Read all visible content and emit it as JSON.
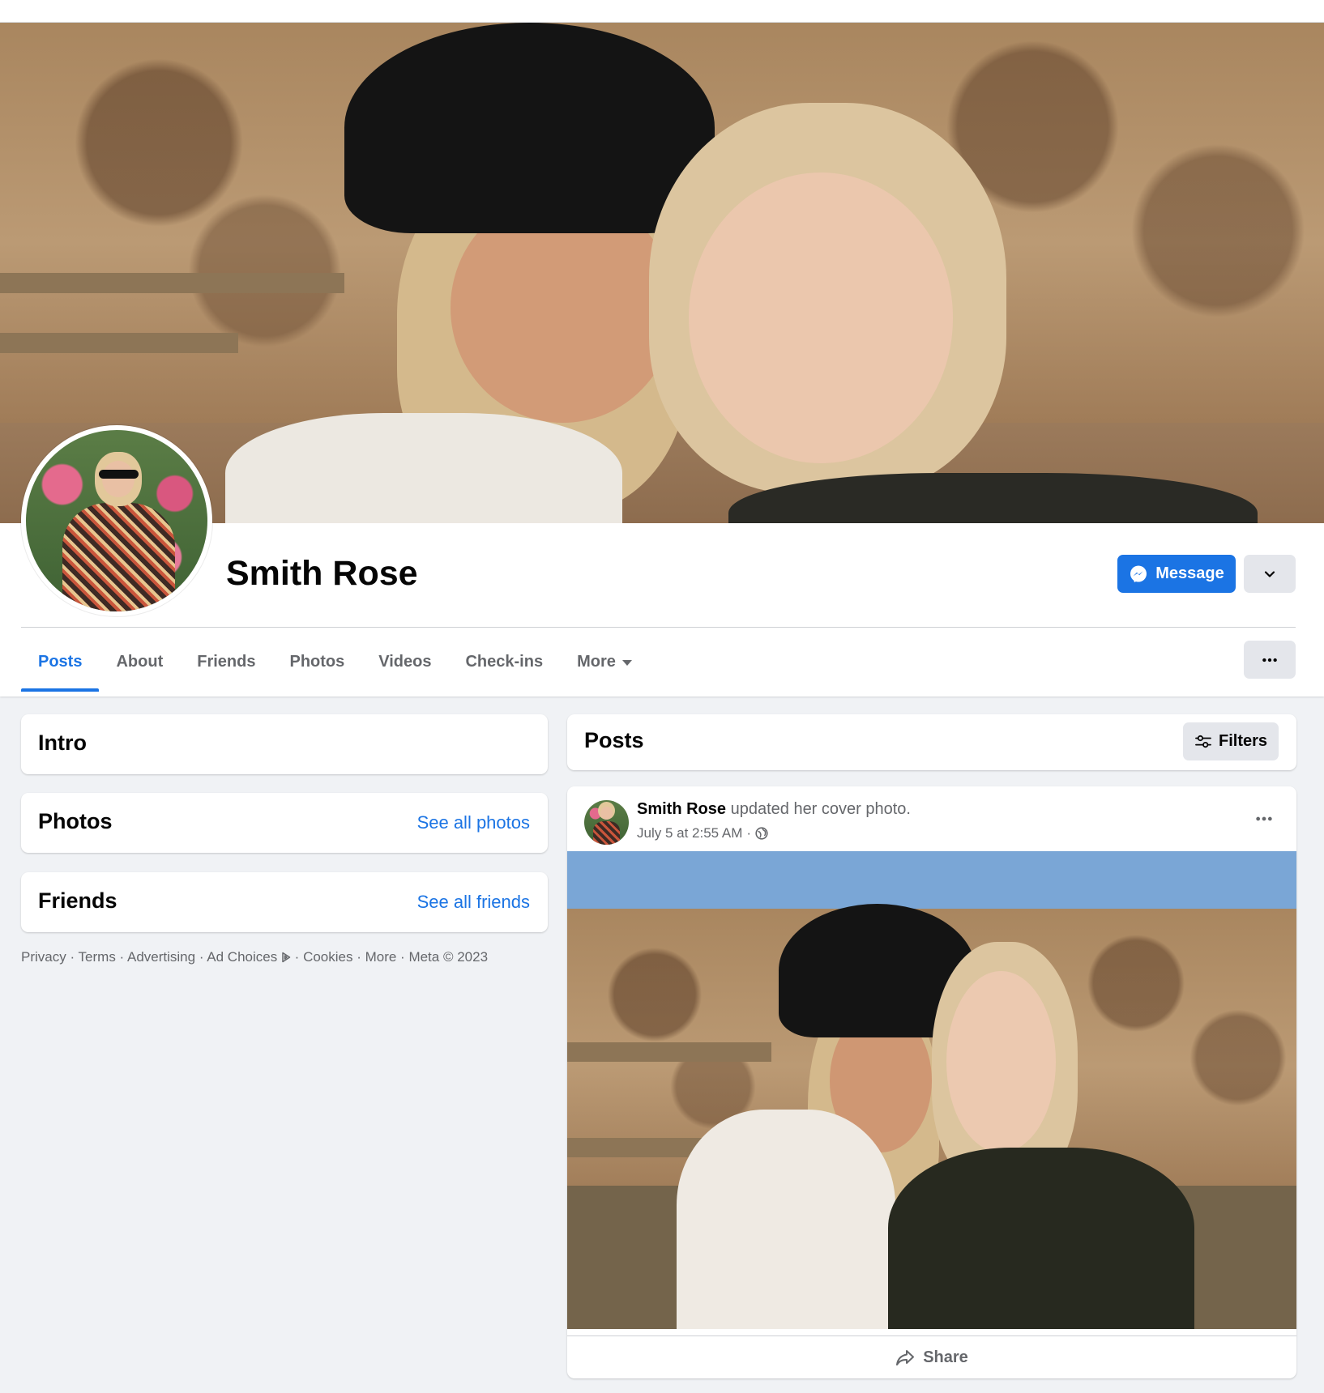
{
  "profile": {
    "name": "Smith Rose",
    "message_label": "Message"
  },
  "tabs": [
    {
      "label": "Posts"
    },
    {
      "label": "About"
    },
    {
      "label": "Friends"
    },
    {
      "label": "Photos"
    },
    {
      "label": "Videos"
    },
    {
      "label": "Check-ins"
    },
    {
      "label": "More"
    }
  ],
  "left": {
    "intro_title": "Intro",
    "photos_title": "Photos",
    "photos_link": "See all photos",
    "friends_title": "Friends",
    "friends_link": "See all friends"
  },
  "footer": {
    "privacy": "Privacy",
    "terms": "Terms",
    "advertising": "Advertising",
    "ad_choices": "Ad Choices",
    "cookies": "Cookies",
    "more": "More",
    "meta": "Meta © 2023",
    "separator": " · "
  },
  "posts": {
    "title": "Posts",
    "filters_label": "Filters"
  },
  "post": {
    "author": "Smith Rose",
    "action": " updated her cover photo.",
    "timestamp": "July 5 at 2:55 AM",
    "dot": " · ",
    "share_label": "Share"
  },
  "colors": {
    "accent": "#1b74e4",
    "background": "#f0f2f5",
    "secondary_text": "#65676b",
    "button_gray": "#e4e6eb"
  },
  "icons": {
    "message": "messenger-icon",
    "dropdown": "chevron-down-icon",
    "more": "more-dots-icon",
    "filters": "sliders-icon",
    "audience": "globe-icon",
    "share": "share-arrow-icon",
    "ad_choices": "ad-choices-icon"
  }
}
